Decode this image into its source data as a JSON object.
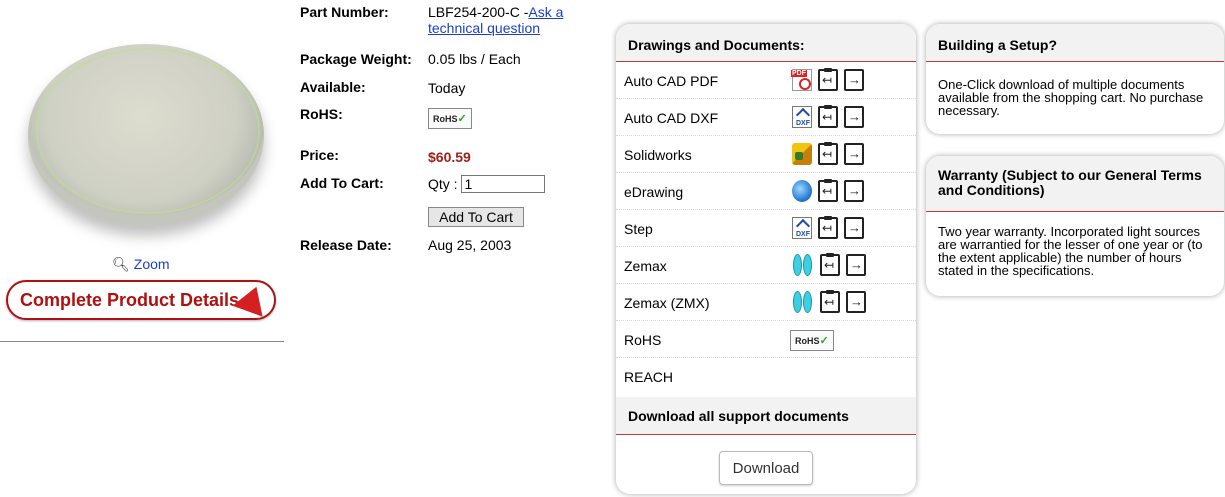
{
  "product": {
    "zoom_label": "Zoom",
    "complete_details_label": "Complete Product Details"
  },
  "specs": {
    "part_number_label": "Part Number:",
    "part_number_value": "LBF254-200-C -",
    "ask_question_line1": "Ask a",
    "ask_question_line2": "technical question",
    "weight_label": "Package Weight:",
    "weight_value": "0.05 lbs / Each",
    "available_label": "Available:",
    "available_value": "Today",
    "rohs_label": "RoHS:",
    "rohs_badge": "RoHS",
    "price_label": "Price:",
    "price_value": "$60.59",
    "cart_label": "Add To Cart:",
    "qty_label": "Qty :",
    "qty_value": "1",
    "add_to_cart_button": "Add To Cart",
    "release_label": "Release Date:",
    "release_value": "Aug 25, 2003"
  },
  "documents": {
    "title": "Drawings and Documents:",
    "items": [
      {
        "name": "Auto CAD PDF",
        "icon": "pdf-icon"
      },
      {
        "name": "Auto CAD DXF",
        "icon": "dxf-icon"
      },
      {
        "name": "Solidworks",
        "icon": "solidworks-icon"
      },
      {
        "name": "eDrawing",
        "icon": "edrawing-icon"
      },
      {
        "name": "Step",
        "icon": "dxf-icon"
      },
      {
        "name": "Zemax",
        "icon": "lens-icon"
      },
      {
        "name": "Zemax (ZMX)",
        "icon": "lens-icon"
      },
      {
        "name": "RoHS",
        "icon": "rohs-badge"
      },
      {
        "name": "REACH",
        "icon": ""
      }
    ],
    "rohs_badge": "RoHS",
    "download_all_title": "Download all support documents",
    "download_button": "Download"
  },
  "setup": {
    "title": "Building a Setup?",
    "body": "One-Click download of multiple documents available from the shopping cart. No purchase necessary."
  },
  "warranty": {
    "title": "Warranty (Subject to our General Terms and Conditions)",
    "body": "Two year warranty. Incorporated light sources are warrantied for the lesser of one year or (to the extent applicable) the number of hours stated in the specifications."
  },
  "colors": {
    "accent_red": "#c23b3b",
    "price_red": "#a0201a",
    "link_blue": "#1a3fcc"
  }
}
